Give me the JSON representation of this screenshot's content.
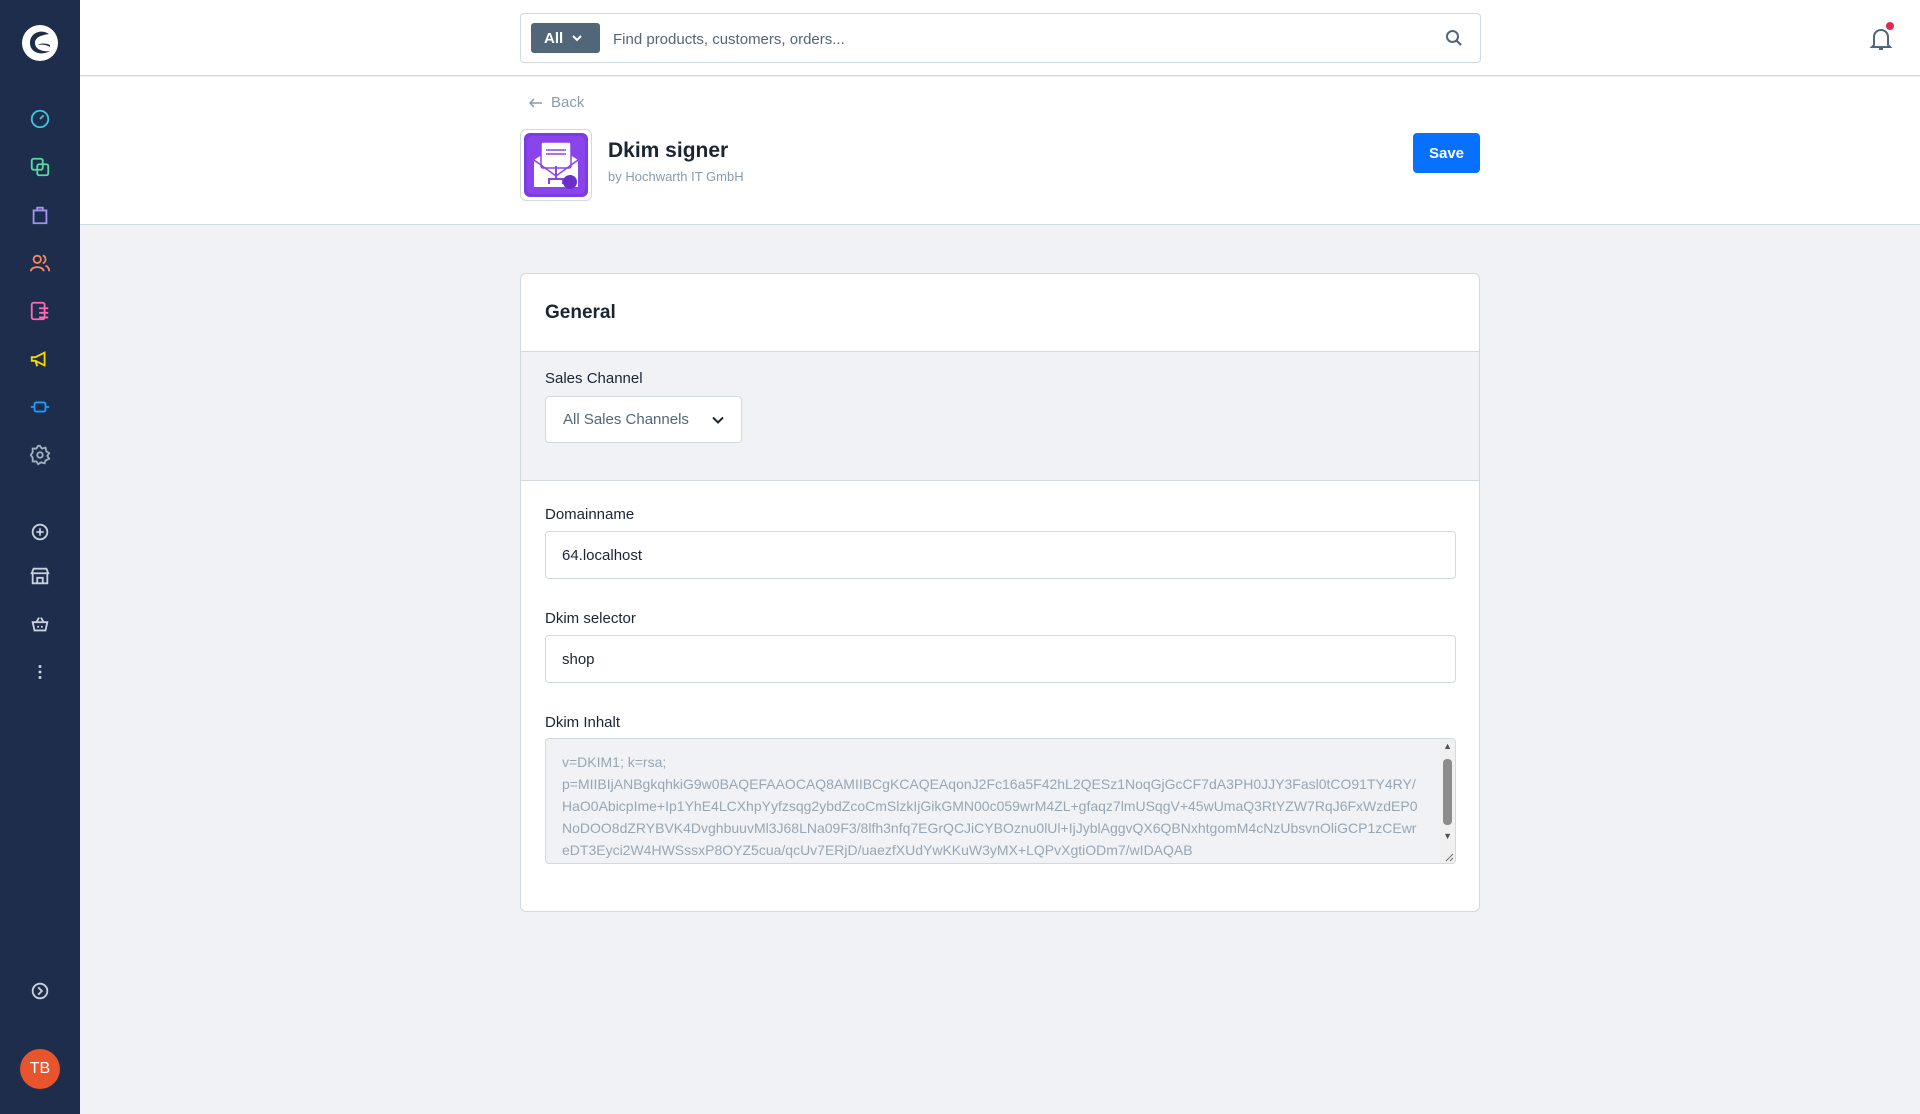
{
  "search": {
    "type_label": "All",
    "placeholder": "Find products, customers, orders..."
  },
  "header": {
    "back_label": "Back",
    "title": "Dkim signer",
    "vendor": "by Hochwarth IT GmbH",
    "save_label": "Save"
  },
  "user": {
    "initials": "TB"
  },
  "card": {
    "title": "General",
    "sales_channel": {
      "label": "Sales Channel",
      "value": "All Sales Channels"
    },
    "domainname": {
      "label": "Domainname",
      "value": "64.localhost"
    },
    "dkim_selector": {
      "label": "Dkim selector",
      "value": "shop"
    },
    "dkim_inhalt": {
      "label": "Dkim Inhalt",
      "value": "v=DKIM1; k=rsa;\np=MIIBIjANBgkqhkiG9w0BAQEFAAOCAQ8AMIIBCgKCAQEAqonJ2Fc16a5F42hL2QESz1NoqGjGcCF7dA3PH0JJY3Fasl0tCO91TY4RY/HaO0AbicpIme+Ip1YhE4LCXhpYyfzsqg2ybdZcoCmSlzkIjGikGMN00c059wrM4ZL+gfaqz7lmUSqgV+45wUmaQ3RtYZW7RqJ6FxWzdEP0NoDOO8dZRYBVK4DvghbuuvMl3J68LNa09F3/8lfh3nfq7EGrQCJiCYBOznu0lUl+IjJyblAggvQX6QBNxhtgomM4cNzUbsvnOliGCP1zCEwreDT3Eyci2W4HWSssxP8OYZ5cua/qcUv7ERjD/uaezfXUdYwKKuW3yMX+LQPvXgtiODm7/wIDAQAB"
    }
  },
  "colors": {
    "sidebar": "#1e2d4b",
    "primary": "#0870ff",
    "avatar": "#e8542c",
    "notification_dot": "#de294c"
  }
}
